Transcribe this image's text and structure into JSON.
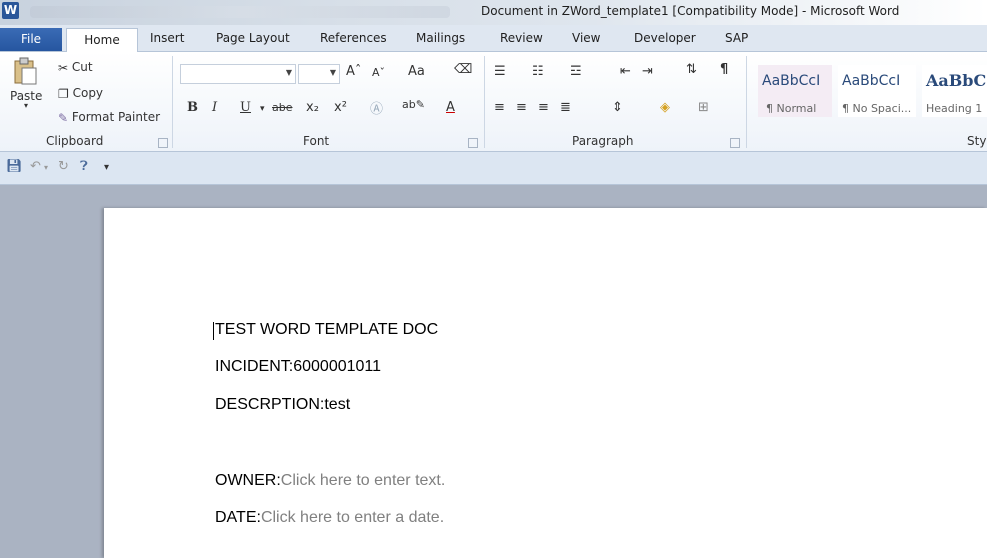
{
  "window": {
    "title": "Document in ZWord_template1 [Compatibility Mode]  -  Microsoft Word",
    "app_icon": "W"
  },
  "tabs": [
    {
      "label": "File",
      "active": false
    },
    {
      "label": "Home",
      "active": true
    },
    {
      "label": "Insert"
    },
    {
      "label": "Page Layout"
    },
    {
      "label": "References"
    },
    {
      "label": "Mailings"
    },
    {
      "label": "Review"
    },
    {
      "label": "View"
    },
    {
      "label": "Developer"
    },
    {
      "label": "SAP"
    }
  ],
  "ribbon": {
    "clipboard": {
      "paste": "Paste",
      "cut": "Cut",
      "copy": "Copy",
      "format_painter": "Format Painter",
      "label": "Clipboard"
    },
    "font": {
      "label": "Font",
      "font_name": "",
      "font_size": "",
      "grow": "Aˆ",
      "shrink": "Aˇ",
      "change_case": "Aa",
      "bold": "B",
      "italic": "I",
      "underline": "U",
      "strikethrough": "abe",
      "subscript": "x₂",
      "superscript": "x²",
      "font_color": "A"
    },
    "paragraph": {
      "label": "Paragraph",
      "pilcrow": "¶"
    },
    "styles": {
      "label": "Sty",
      "items": [
        {
          "sample": "AaBbCcI",
          "name": "¶ Normal"
        },
        {
          "sample": "AaBbCcI",
          "name": "¶ No Spaci..."
        },
        {
          "sample": "AaBbC",
          "name": "Heading 1"
        }
      ]
    }
  },
  "document": {
    "line1": "TEST WORD TEMPLATE DOC",
    "incident_label": "INCIDENT:",
    "incident_value": "6000001011",
    "description_label": "DESCRPTION:",
    "description_value": "test",
    "owner_label": "OWNER:",
    "owner_placeholder": "Click here to enter text.",
    "date_label": "DATE:",
    "date_placeholder": "Click here to enter a date."
  },
  "colors": {
    "file_tab": "#2b579a",
    "ribbon_bg": "#ffffff",
    "workspace": "#aab3c2",
    "placeholder": "#808080"
  }
}
